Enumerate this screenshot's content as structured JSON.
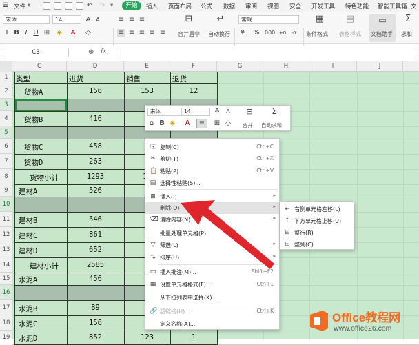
{
  "menubar": {
    "file": "文件",
    "tabs": [
      "开始",
      "插入",
      "页面布局",
      "公式",
      "数据",
      "审阅",
      "视图",
      "安全",
      "开发工具",
      "特色功能",
      "智能工具箱",
      "文..."
    ]
  },
  "ribbon": {
    "font_name": "宋体",
    "font_size": "14",
    "number_format": "常规",
    "merge_label": "合并居中",
    "wrap_label": "自动换行",
    "cond_format_label": "条件格式",
    "table_style_label": "表格样式",
    "doc_helper_label": "文档助手",
    "sum_label": "求和"
  },
  "formula_bar": {
    "name_box": "C3",
    "fx": "fx"
  },
  "col_headers": [
    "C",
    "D",
    "E",
    "F",
    "G",
    "H",
    "I",
    "J"
  ],
  "row_headers": [
    "1",
    "2",
    "3",
    "4",
    "5",
    "6",
    "7",
    "8",
    "9",
    "10",
    "11",
    "12",
    "13",
    "14",
    "15",
    "16",
    "17",
    "18",
    "19"
  ],
  "table": {
    "headers": [
      "类型",
      "进货",
      "销售",
      "退货"
    ],
    "rows": [
      [
        "货物A",
        "156",
        "153",
        "12"
      ],
      [
        "",
        "",
        "",
        ""
      ],
      [
        "货物B",
        "416",
        "6",
        ""
      ],
      [
        "",
        "",
        "",
        ""
      ],
      [
        "货物C",
        "458",
        "",
        ""
      ],
      [
        "货物D",
        "263",
        "5",
        ""
      ],
      [
        "货物小计",
        "1293",
        "13",
        ""
      ],
      [
        "建材A",
        "526",
        "1",
        ""
      ],
      [
        "",
        "",
        "",
        ""
      ],
      [
        "建材B",
        "546",
        "",
        ""
      ],
      [
        "建材C",
        "861",
        "5",
        ""
      ],
      [
        "建材D",
        "652",
        "2",
        ""
      ],
      [
        "建材小计",
        "2585",
        "9",
        ""
      ],
      [
        "水泥A",
        "456",
        "2",
        ""
      ],
      [
        "",
        "",
        "",
        ""
      ],
      [
        "水泥B",
        "89",
        "1",
        ""
      ],
      [
        "水泥C",
        "156",
        "5",
        ""
      ],
      [
        "水泥D",
        "852",
        "123",
        "1"
      ]
    ]
  },
  "mini_toolbar": {
    "font_name": "宋体",
    "font_size": "14",
    "merge_label": "合并",
    "autosum_label": "自动求和"
  },
  "context_menu": [
    {
      "label": "复制(C)",
      "shortcut": "Ctrl+C",
      "icon": "copy-icon",
      "glyph": "⎘"
    },
    {
      "label": "剪切(T)",
      "shortcut": "Ctrl+X",
      "icon": "scissors-icon",
      "glyph": "✂"
    },
    {
      "label": "粘贴(P)",
      "shortcut": "Ctrl+V",
      "icon": "paste-icon",
      "glyph": "📋"
    },
    {
      "label": "选择性粘贴(S)...",
      "shortcut": "",
      "icon": "paste-special-icon",
      "glyph": "▤"
    },
    {
      "label": "插入(I)",
      "shortcut": "",
      "icon": "insert-icon",
      "glyph": "⊞",
      "arrow": true
    },
    {
      "label": "删除(D)",
      "shortcut": "",
      "icon": "",
      "glyph": "",
      "arrow": true,
      "highlight": true
    },
    {
      "label": "清除内容(N)",
      "shortcut": "",
      "icon": "eraser-icon",
      "glyph": "⌫",
      "arrow": true
    },
    {
      "label": "批量处理单元格(P)",
      "shortcut": "",
      "icon": "",
      "glyph": ""
    },
    {
      "label": "筛选(L)",
      "shortcut": "",
      "icon": "filter-icon",
      "glyph": "▽",
      "arrow": true
    },
    {
      "label": "排序(U)",
      "shortcut": "",
      "icon": "sort-icon",
      "glyph": "⇅",
      "arrow": true
    },
    {
      "label": "插入批注(M)...",
      "shortcut": "Shift+F2",
      "icon": "comment-icon",
      "glyph": "▭"
    },
    {
      "label": "设置单元格格式(F)...",
      "shortcut": "Ctrl+1",
      "icon": "format-cells-icon",
      "glyph": "▦"
    },
    {
      "label": "从下拉列表中选择(K)...",
      "shortcut": "",
      "icon": "",
      "glyph": ""
    },
    {
      "label": "超链接(H)...",
      "shortcut": "Ctrl+K",
      "icon": "link-icon",
      "glyph": "🔗",
      "disabled": true
    },
    {
      "label": "定义名称(A)...",
      "shortcut": "",
      "icon": "",
      "glyph": ""
    }
  ],
  "submenu": [
    {
      "label": "右侧单元格左移(L)",
      "icon": "shift-left-icon",
      "glyph": "⇤"
    },
    {
      "label": "下方单元格上移(U)",
      "icon": "shift-up-icon",
      "glyph": "⇡"
    },
    {
      "label": "整行(R)",
      "icon": "delete-row-icon",
      "glyph": "⊟"
    },
    {
      "label": "整列(C)",
      "icon": "delete-column-icon",
      "glyph": "⊞"
    }
  ],
  "watermark": {
    "brand": "Office教程网",
    "url": "www.office26.com"
  },
  "colors": {
    "accent": "#26a65b",
    "grid_bg": "#c9e9cf",
    "arrow": "#e0262d",
    "logo_orange": "#f26b21"
  }
}
